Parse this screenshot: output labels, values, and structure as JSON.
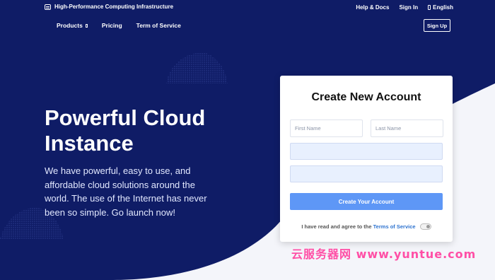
{
  "header": {
    "brand": "High-Performance Computing Infrastructure",
    "top_links": {
      "help": "Help & Docs",
      "signin": "Sign In",
      "language": "English"
    },
    "nav": {
      "products": "Products",
      "pricing": "Pricing",
      "terms": "Term of Service"
    },
    "signup": "Sign Up"
  },
  "hero": {
    "title_line1": "Powerful Cloud",
    "title_line2": "Instance",
    "description": "We have powerful, easy to use, and affordable cloud solutions around the world. The use of the Internet has never been so simple. Go launch now!"
  },
  "signup_form": {
    "title": "Create New Account",
    "first_name_placeholder": "First Name",
    "last_name_placeholder": "Last Name",
    "email_value": "",
    "password_value": "",
    "submit_label": "Create Your Account",
    "agree_text": "I have read and agree to the",
    "terms_link": "Terms of Service"
  },
  "watermark": "云服务器网 www.yuntue.com",
  "colors": {
    "navy": "#0f1c66",
    "button": "#5e97f6",
    "link": "#2f74d0",
    "watermark": "#ff4fa6"
  },
  "icons": {
    "brand": "server-icon",
    "language": "globe-icon",
    "products": "dropdown-icon",
    "toggle": "toggle-off-icon"
  }
}
